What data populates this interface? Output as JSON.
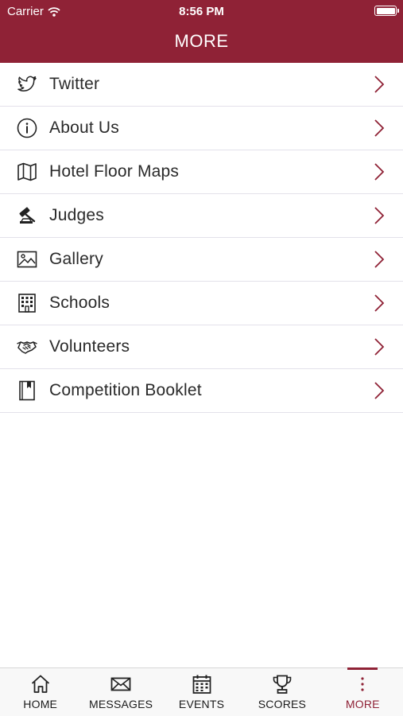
{
  "status_bar": {
    "carrier": "Carrier",
    "time": "8:56 PM"
  },
  "header": {
    "title": "MORE"
  },
  "menu": {
    "items": [
      {
        "label": "Twitter",
        "icon": "twitter-icon"
      },
      {
        "label": "About Us",
        "icon": "info-icon"
      },
      {
        "label": "Hotel Floor Maps",
        "icon": "map-icon"
      },
      {
        "label": "Judges",
        "icon": "gavel-icon"
      },
      {
        "label": "Gallery",
        "icon": "image-icon"
      },
      {
        "label": "Schools",
        "icon": "building-icon"
      },
      {
        "label": "Volunteers",
        "icon": "handshake-icon"
      },
      {
        "label": "Competition Booklet",
        "icon": "booklet-icon"
      }
    ]
  },
  "tabbar": {
    "tabs": [
      {
        "label": "HOME",
        "icon": "home-icon"
      },
      {
        "label": "MESSAGES",
        "icon": "envelope-icon"
      },
      {
        "label": "EVENTS",
        "icon": "calendar-icon"
      },
      {
        "label": "SCORES",
        "icon": "trophy-icon"
      },
      {
        "label": "MORE",
        "icon": "more-dots-icon"
      }
    ],
    "active": "MORE"
  },
  "colors": {
    "brand": "#8f2236",
    "divider": "#e3e1ea",
    "text": "#2a2a2a"
  }
}
